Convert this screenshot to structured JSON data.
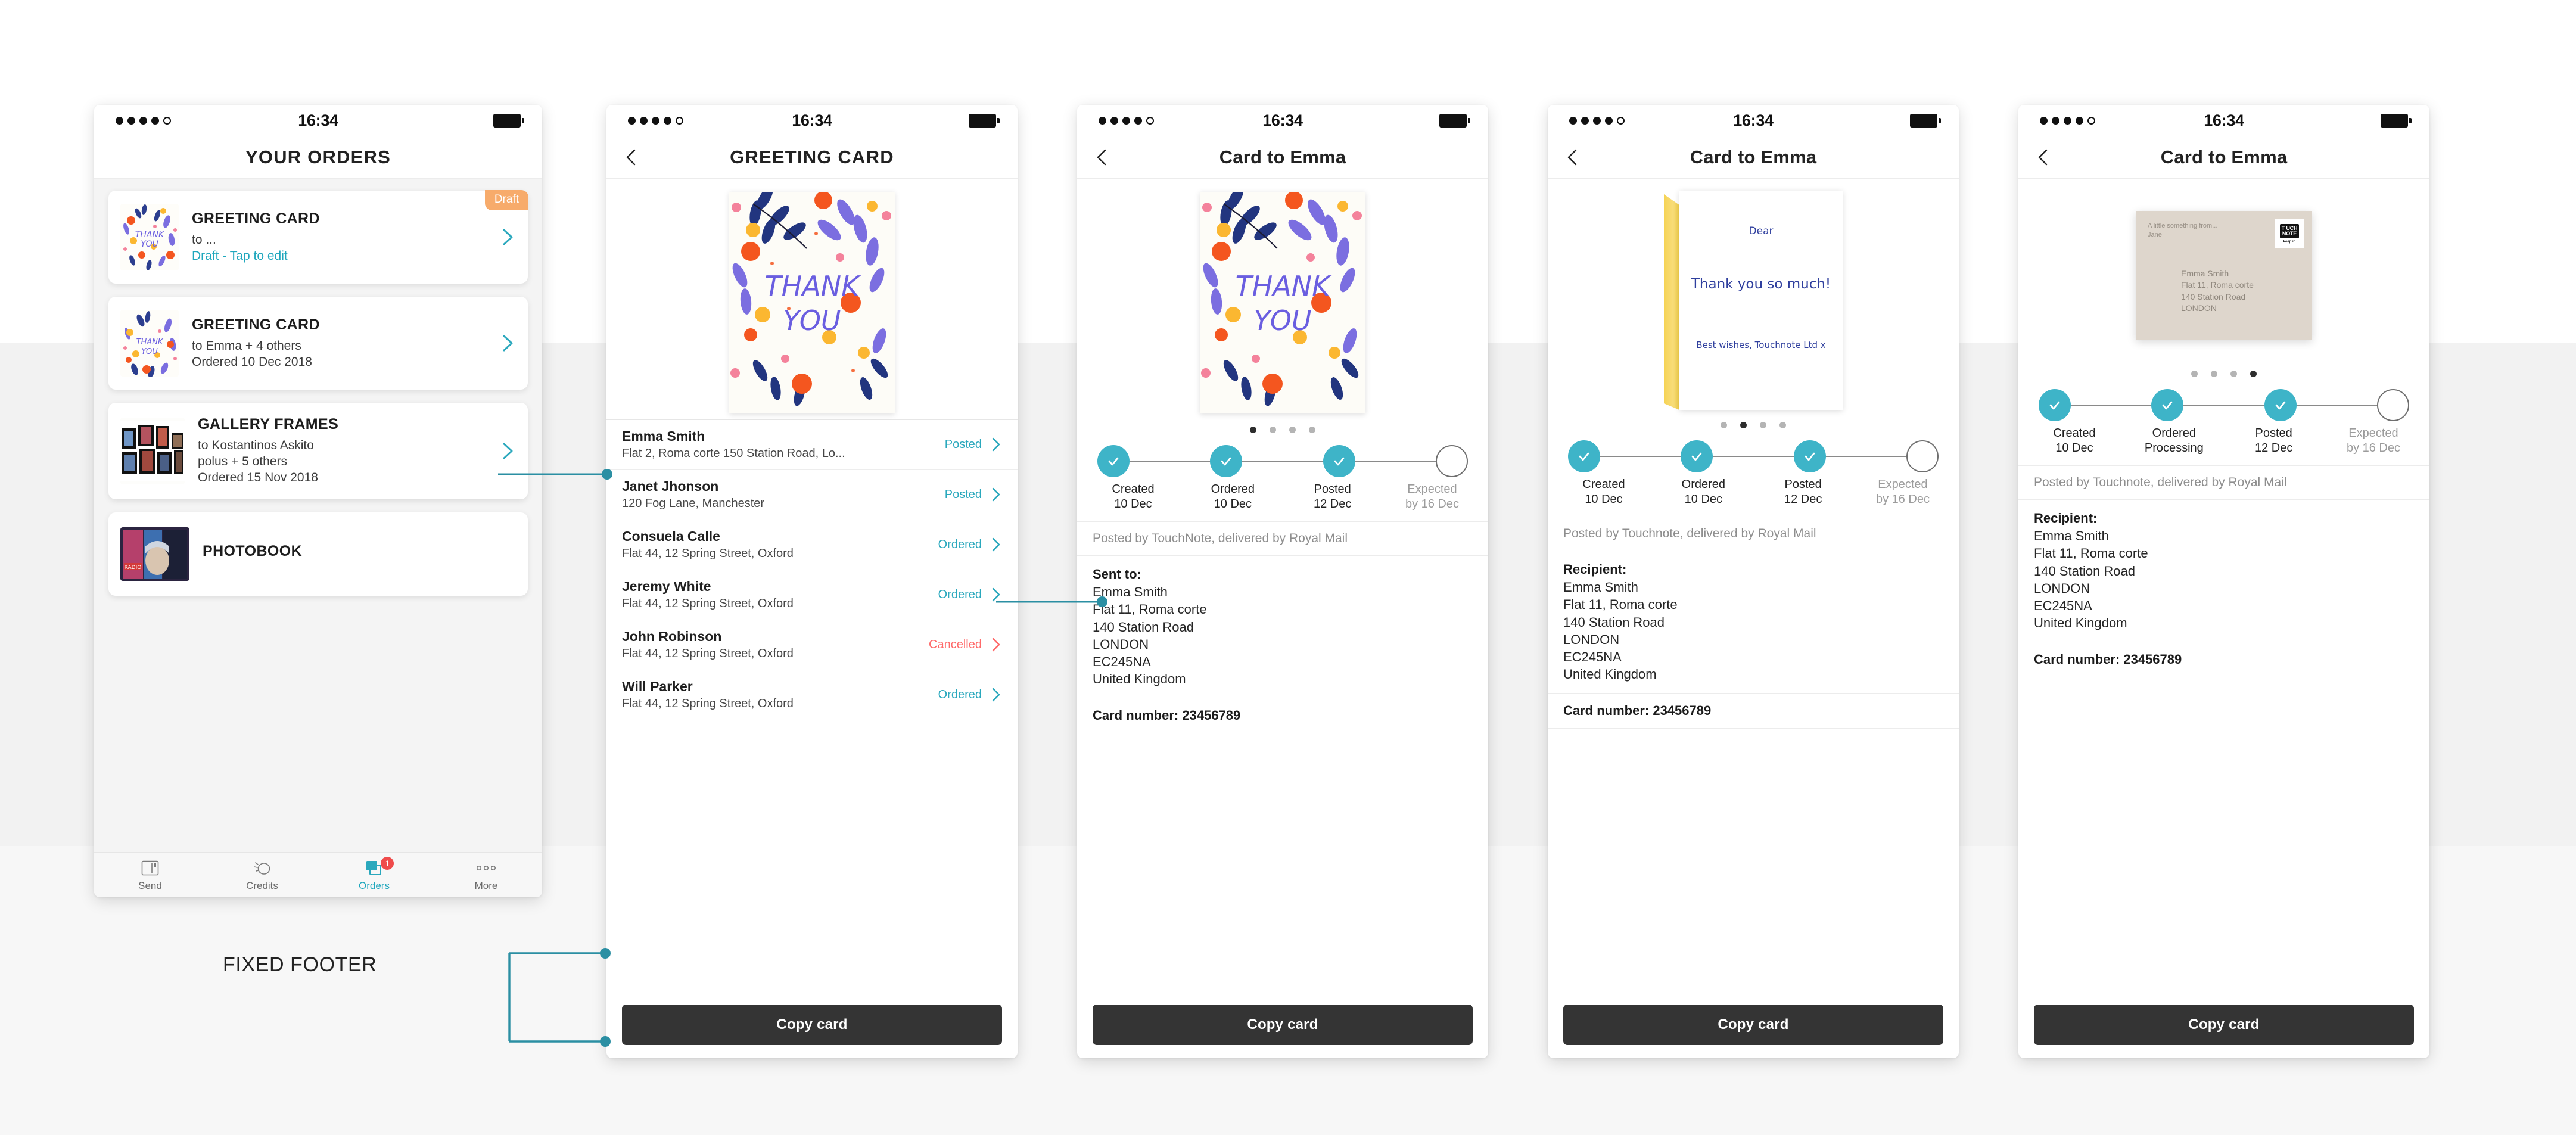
{
  "annotations": {
    "fixed_footer_label": "FIXED FOOTER"
  },
  "colors": {
    "accent": "#2aa8bd",
    "tracker_done": "#3eb4c8",
    "cancelled": "#ff6a6a",
    "draft_badge": "#f7ab6b",
    "button_dark": "#343434",
    "connector": "#2b8fa3"
  },
  "screens": [
    {
      "id": "orders",
      "status_bar": {
        "time": "16:34",
        "signal_dots": 5,
        "signal_filled": 4,
        "battery": "full"
      },
      "nav": {
        "title": "YOUR ORDERS",
        "has_back": false
      },
      "orders": [
        {
          "badge": "Draft",
          "title": "GREETING CARD",
          "line1": "to ...",
          "line2": "Draft - Tap to edit",
          "line2_is_link": true,
          "thumb": "thank-you-floral-card"
        },
        {
          "badge": "",
          "title": "GREETING CARD",
          "line1": "to Emma + 4 others",
          "line2": "Ordered 10 Dec 2018",
          "line2_is_link": false,
          "thumb": "thank-you-floral-card"
        },
        {
          "badge": "",
          "title": "GALLERY FRAMES",
          "line1": "to Kostantinos Askito",
          "line1b": "polus + 5 others",
          "line2": "Ordered 15 Nov 2018",
          "line2_is_link": false,
          "thumb": "gallery-frames-collage"
        },
        {
          "badge": "",
          "title": "PHOTOBOOK",
          "line1": "",
          "line2": "",
          "line2_is_link": false,
          "thumb": "photobook-cover"
        }
      ],
      "tabbar": [
        {
          "label": "Send",
          "icon": "send-card-icon",
          "active": false,
          "badge": ""
        },
        {
          "label": "Credits",
          "icon": "coin-icon",
          "active": false,
          "badge": ""
        },
        {
          "label": "Orders",
          "icon": "orders-icon",
          "active": true,
          "badge": "1"
        },
        {
          "label": "More",
          "icon": "more-dots-icon",
          "active": false,
          "badge": ""
        }
      ]
    },
    {
      "id": "greeting-card-recipients",
      "status_bar": {
        "time": "16:34"
      },
      "nav": {
        "title": "GREETING CARD",
        "has_back": true
      },
      "recipients": [
        {
          "name": "Emma Smith",
          "address": "Flat 2, Roma corte 150 Station Road, Lo...",
          "status": "Posted",
          "status_type": "posted"
        },
        {
          "name": "Janet Jhonson",
          "address": "120 Fog Lane, Manchester",
          "status": "Posted",
          "status_type": "posted"
        },
        {
          "name": "Consuela Calle",
          "address": "Flat 44, 12 Spring Street, Oxford",
          "status": "Ordered",
          "status_type": "ordered"
        },
        {
          "name": "Jeremy White",
          "address": "Flat 44, 12 Spring Street, Oxford",
          "status": "Ordered",
          "status_type": "ordered"
        },
        {
          "name": "John Robinson",
          "address": "Flat 44, 12 Spring Street, Oxford",
          "status": "Cancelled",
          "status_type": "cancelled"
        },
        {
          "name": "Will Parker",
          "address": "Flat 44, 12 Spring Street, Oxford",
          "status": "Ordered",
          "status_type": "ordered"
        }
      ],
      "primary_button": "Copy card"
    },
    {
      "id": "card-to-emma-front",
      "status_bar": {
        "time": "16:34"
      },
      "nav": {
        "title": "Card to Emma",
        "has_back": true
      },
      "pager": {
        "count": 4,
        "active": 0
      },
      "tracker": [
        {
          "label": "Created",
          "date": "10 Dec",
          "done": true
        },
        {
          "label": "Ordered",
          "date": "10 Dec",
          "done": true
        },
        {
          "label": "Posted",
          "date": "12 Dec",
          "done": true
        },
        {
          "label": "Expected",
          "date": "by 16 Dec",
          "done": false
        }
      ],
      "delivery_note": "Posted by TouchNote, delivered by Royal Mail",
      "address_heading": "Sent to:",
      "address_lines": [
        "Emma Smith",
        "Flat 11, Roma corte",
        "140 Station Road",
        "LONDON",
        "EC245NA",
        "United Kingdom"
      ],
      "card_number": "Card number: 23456789",
      "primary_button": "Copy card"
    },
    {
      "id": "card-to-emma-inside",
      "status_bar": {
        "time": "16:34"
      },
      "nav": {
        "title": "Card to Emma",
        "has_back": true
      },
      "inside_message": {
        "greeting": "Dear",
        "body": "Thank you so much!",
        "signature": "Best wishes, Touchnote Ltd x"
      },
      "pager": {
        "count": 4,
        "active": 1
      },
      "tracker": [
        {
          "label": "Created",
          "date": "10 Dec",
          "done": true
        },
        {
          "label": "Ordered",
          "date": "10 Dec",
          "done": true
        },
        {
          "label": "Posted",
          "date": "12 Dec",
          "done": true
        },
        {
          "label": "Expected",
          "date": "by 16 Dec",
          "done": false
        }
      ],
      "delivery_note": "Posted by Touchnote, delivered by Royal Mail",
      "address_heading": "Recipient:",
      "address_lines": [
        "Emma Smith",
        "Flat 11, Roma corte",
        "140 Station Road",
        "LONDON",
        "EC245NA",
        "United Kingdom"
      ],
      "card_number": "Card number: 23456789",
      "primary_button": "Copy card"
    },
    {
      "id": "card-to-emma-envelope",
      "status_bar": {
        "time": "16:34"
      },
      "nav": {
        "title": "Card to Emma",
        "has_back": true
      },
      "envelope": {
        "from_line1": "A little something from...",
        "from_line2": "Jane",
        "to_lines": [
          "Emma Smith",
          "Flat 11, Roma corte",
          "140 Station Road",
          "LONDON"
        ],
        "stamp_top": "T UCH",
        "stamp_mid": "NOTE",
        "stamp_sub": "keep in"
      },
      "pager": {
        "count": 4,
        "active": 3
      },
      "tracker": [
        {
          "label": "Created",
          "date": "10 Dec",
          "done": true
        },
        {
          "label": "Ordered",
          "date": "Processing",
          "done": true
        },
        {
          "label": "Posted",
          "date": "12 Dec",
          "done": true
        },
        {
          "label": "Expected",
          "date": "by 16 Dec",
          "done": false
        }
      ],
      "delivery_note": "Posted by Touchnote, delivered by Royal Mail",
      "address_heading": "Recipient:",
      "address_lines": [
        "Emma Smith",
        "Flat 11, Roma corte",
        "140 Station Road",
        "LONDON",
        "EC245NA",
        "United Kingdom"
      ],
      "card_number": "Card number: 23456789",
      "primary_button": "Copy card"
    }
  ]
}
